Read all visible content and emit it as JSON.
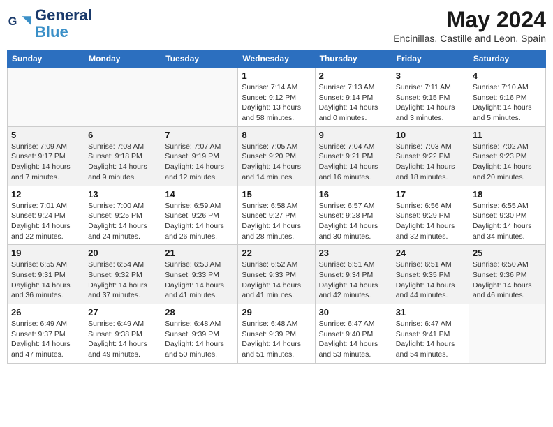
{
  "header": {
    "logo_line1": "General",
    "logo_line2": "Blue",
    "main_title": "May 2024",
    "subtitle": "Encinillas, Castille and Leon, Spain"
  },
  "weekdays": [
    "Sunday",
    "Monday",
    "Tuesday",
    "Wednesday",
    "Thursday",
    "Friday",
    "Saturday"
  ],
  "weeks": [
    [
      {
        "day": "",
        "info": ""
      },
      {
        "day": "",
        "info": ""
      },
      {
        "day": "",
        "info": ""
      },
      {
        "day": "1",
        "info": "Sunrise: 7:14 AM\nSunset: 9:12 PM\nDaylight: 13 hours\nand 58 minutes."
      },
      {
        "day": "2",
        "info": "Sunrise: 7:13 AM\nSunset: 9:14 PM\nDaylight: 14 hours\nand 0 minutes."
      },
      {
        "day": "3",
        "info": "Sunrise: 7:11 AM\nSunset: 9:15 PM\nDaylight: 14 hours\nand 3 minutes."
      },
      {
        "day": "4",
        "info": "Sunrise: 7:10 AM\nSunset: 9:16 PM\nDaylight: 14 hours\nand 5 minutes."
      }
    ],
    [
      {
        "day": "5",
        "info": "Sunrise: 7:09 AM\nSunset: 9:17 PM\nDaylight: 14 hours\nand 7 minutes."
      },
      {
        "day": "6",
        "info": "Sunrise: 7:08 AM\nSunset: 9:18 PM\nDaylight: 14 hours\nand 9 minutes."
      },
      {
        "day": "7",
        "info": "Sunrise: 7:07 AM\nSunset: 9:19 PM\nDaylight: 14 hours\nand 12 minutes."
      },
      {
        "day": "8",
        "info": "Sunrise: 7:05 AM\nSunset: 9:20 PM\nDaylight: 14 hours\nand 14 minutes."
      },
      {
        "day": "9",
        "info": "Sunrise: 7:04 AM\nSunset: 9:21 PM\nDaylight: 14 hours\nand 16 minutes."
      },
      {
        "day": "10",
        "info": "Sunrise: 7:03 AM\nSunset: 9:22 PM\nDaylight: 14 hours\nand 18 minutes."
      },
      {
        "day": "11",
        "info": "Sunrise: 7:02 AM\nSunset: 9:23 PM\nDaylight: 14 hours\nand 20 minutes."
      }
    ],
    [
      {
        "day": "12",
        "info": "Sunrise: 7:01 AM\nSunset: 9:24 PM\nDaylight: 14 hours\nand 22 minutes."
      },
      {
        "day": "13",
        "info": "Sunrise: 7:00 AM\nSunset: 9:25 PM\nDaylight: 14 hours\nand 24 minutes."
      },
      {
        "day": "14",
        "info": "Sunrise: 6:59 AM\nSunset: 9:26 PM\nDaylight: 14 hours\nand 26 minutes."
      },
      {
        "day": "15",
        "info": "Sunrise: 6:58 AM\nSunset: 9:27 PM\nDaylight: 14 hours\nand 28 minutes."
      },
      {
        "day": "16",
        "info": "Sunrise: 6:57 AM\nSunset: 9:28 PM\nDaylight: 14 hours\nand 30 minutes."
      },
      {
        "day": "17",
        "info": "Sunrise: 6:56 AM\nSunset: 9:29 PM\nDaylight: 14 hours\nand 32 minutes."
      },
      {
        "day": "18",
        "info": "Sunrise: 6:55 AM\nSunset: 9:30 PM\nDaylight: 14 hours\nand 34 minutes."
      }
    ],
    [
      {
        "day": "19",
        "info": "Sunrise: 6:55 AM\nSunset: 9:31 PM\nDaylight: 14 hours\nand 36 minutes."
      },
      {
        "day": "20",
        "info": "Sunrise: 6:54 AM\nSunset: 9:32 PM\nDaylight: 14 hours\nand 37 minutes."
      },
      {
        "day": "21",
        "info": "Sunrise: 6:53 AM\nSunset: 9:33 PM\nDaylight: 14 hours\nand 41 minutes."
      },
      {
        "day": "22",
        "info": "Sunrise: 6:52 AM\nSunset: 9:33 PM\nDaylight: 14 hours\nand 41 minutes."
      },
      {
        "day": "23",
        "info": "Sunrise: 6:51 AM\nSunset: 9:34 PM\nDaylight: 14 hours\nand 42 minutes."
      },
      {
        "day": "24",
        "info": "Sunrise: 6:51 AM\nSunset: 9:35 PM\nDaylight: 14 hours\nand 44 minutes."
      },
      {
        "day": "25",
        "info": "Sunrise: 6:50 AM\nSunset: 9:36 PM\nDaylight: 14 hours\nand 46 minutes."
      }
    ],
    [
      {
        "day": "26",
        "info": "Sunrise: 6:49 AM\nSunset: 9:37 PM\nDaylight: 14 hours\nand 47 minutes."
      },
      {
        "day": "27",
        "info": "Sunrise: 6:49 AM\nSunset: 9:38 PM\nDaylight: 14 hours\nand 49 minutes."
      },
      {
        "day": "28",
        "info": "Sunrise: 6:48 AM\nSunset: 9:39 PM\nDaylight: 14 hours\nand 50 minutes."
      },
      {
        "day": "29",
        "info": "Sunrise: 6:48 AM\nSunset: 9:39 PM\nDaylight: 14 hours\nand 51 minutes."
      },
      {
        "day": "30",
        "info": "Sunrise: 6:47 AM\nSunset: 9:40 PM\nDaylight: 14 hours\nand 53 minutes."
      },
      {
        "day": "31",
        "info": "Sunrise: 6:47 AM\nSunset: 9:41 PM\nDaylight: 14 hours\nand 54 minutes."
      },
      {
        "day": "",
        "info": ""
      }
    ]
  ]
}
